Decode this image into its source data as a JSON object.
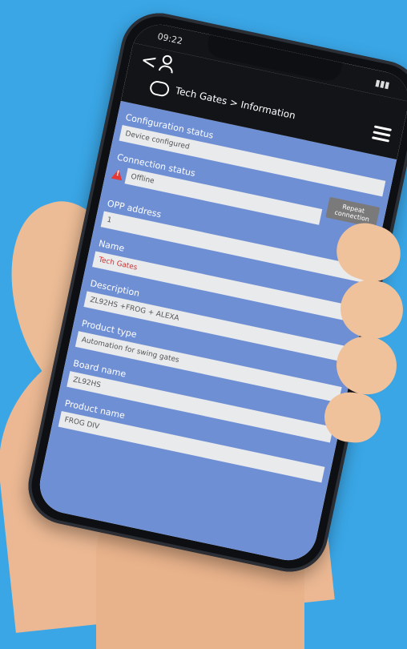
{
  "status_bar": {
    "time": "09:22"
  },
  "header": {
    "title": "Tech Gates > Information"
  },
  "fields": [
    {
      "label": "Configuration status",
      "value": "Device configured"
    },
    {
      "label": "Connection status",
      "value": "Offline",
      "button": "Repeat connection",
      "warning": true
    },
    {
      "label": "OPP address",
      "value": "1"
    },
    {
      "label": "Name",
      "value": "Tech Gates"
    },
    {
      "label": "Description",
      "value": "ZL92HS +FROG + ALEXA"
    },
    {
      "label": "Product type",
      "value": "Automation for swing gates"
    },
    {
      "label": "Board name",
      "value": "ZL92HS"
    },
    {
      "label": "Product name",
      "value": "FROG DIV"
    }
  ],
  "colors": {
    "background": "#3aa6e6",
    "panel": "#6f8fd4",
    "field": "#e9eaec",
    "button": "#7a7a7a",
    "warning": "#e53935"
  }
}
